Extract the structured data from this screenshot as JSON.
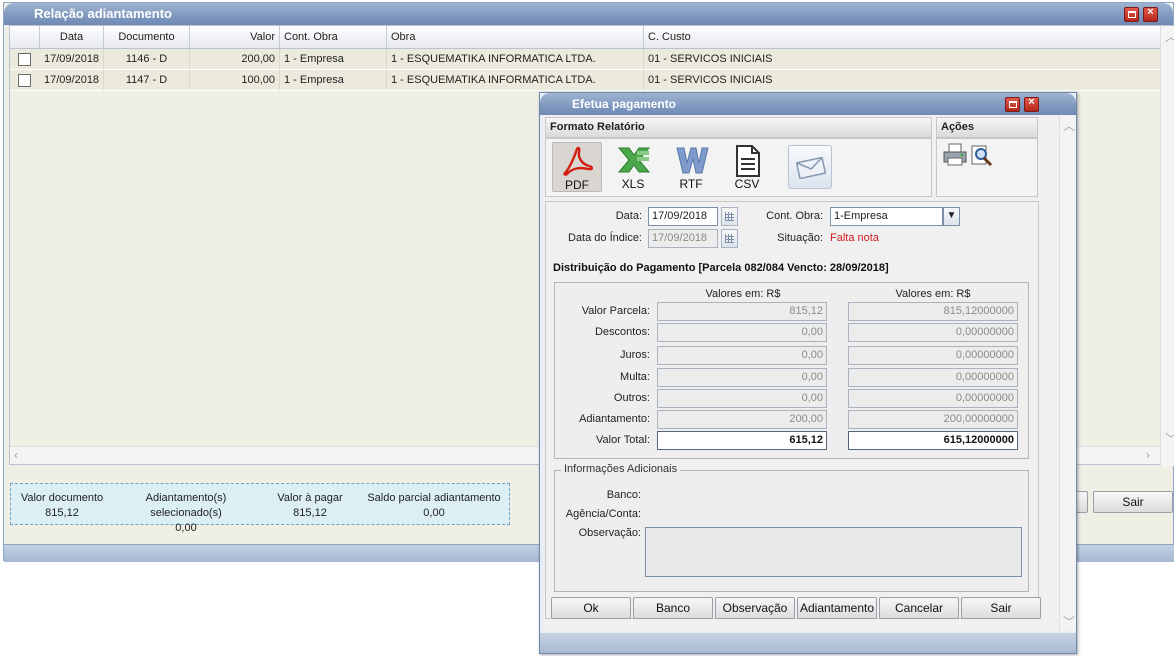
{
  "back_window": {
    "title": "Relação adiantamento",
    "columns": [
      "Data",
      "Documento",
      "Valor",
      "Cont. Obra",
      "Obra",
      "C. Custo"
    ],
    "rows": [
      {
        "data": "17/09/2018",
        "documento": "1146 - D",
        "valor": "200,00",
        "cont_obra": "1 - Empresa",
        "obra": "1 - ESQUEMATIKA INFORMATICA LTDA.",
        "c_custo": "01 - SERVICOS INICIAIS"
      },
      {
        "data": "17/09/2018",
        "documento": "1147 - D",
        "valor": "100,00",
        "cont_obra": "1 - Empresa",
        "obra": "1 - ESQUEMATIKA INFORMATICA LTDA.",
        "c_custo": "01 - SERVICOS INICIAIS"
      }
    ],
    "summary": {
      "valor_documento_label": "Valor documento",
      "valor_documento": "815,12",
      "adiantamentos_label": "Adiantamento(s) selecionado(s)",
      "adiantamentos": "0,00",
      "valor_a_pagar_label": "Valor à pagar",
      "valor_a_pagar": "815,12",
      "saldo_label": "Saldo parcial adiantamento",
      "saldo": "0,00"
    },
    "sair_label": "Sair"
  },
  "dialog": {
    "title": "Efetua pagamento",
    "formato_relatorio": "Formato Relatório",
    "acoes": "Ações",
    "formats": [
      {
        "label": "PDF",
        "icon": "pdf-icon"
      },
      {
        "label": "XLS",
        "icon": "xls-icon"
      },
      {
        "label": "RTF",
        "icon": "rtf-icon"
      },
      {
        "label": "CSV",
        "icon": "csv-icon"
      }
    ],
    "email_icon": "envelope-icon",
    "actions_icons": [
      "printer-icon",
      "print-preview-icon"
    ],
    "form": {
      "data_label": "Data:",
      "data_value": "17/09/2018",
      "data_indice_label": "Data do Índice:",
      "data_indice_value": "17/09/2018",
      "cont_obra_label": "Cont. Obra:",
      "cont_obra_value": "1-Empresa",
      "situacao_label": "Situação:",
      "situacao_value": "Falta nota"
    },
    "distribuicao_title": "Distribuição do Pagamento [Parcela 082/084 Vencto: 28/09/2018]",
    "valores_em_1": "Valores em: R$",
    "valores_em_2": "Valores em: R$",
    "dist_rows": [
      {
        "label": "Valor Parcela:",
        "v1": "815,12",
        "v2": "815,12000000"
      },
      {
        "label": "Descontos:",
        "v1": "0,00",
        "v2": "0,00000000"
      },
      {
        "label": "Juros:",
        "v1": "0,00",
        "v2": "0,00000000"
      },
      {
        "label": "Multa:",
        "v1": "0,00",
        "v2": "0,00000000"
      },
      {
        "label": "Outros:",
        "v1": "0,00",
        "v2": "0,00000000"
      },
      {
        "label": "Adiantamento:",
        "v1": "200,00",
        "v2": "200,00000000"
      },
      {
        "label": "Valor Total:",
        "v1": "615,12",
        "v2": "615,12000000"
      }
    ],
    "info": {
      "legend": "Informações Adicionais",
      "banco_label": "Banco:",
      "agencia_label": "Agência/Conta:",
      "observacao_label": "Observação:"
    },
    "buttons": {
      "ok": "Ok",
      "banco": "Banco",
      "observacao": "Observação",
      "adiantamento": "Adiantamento",
      "cancelar": "Cancelar",
      "sair": "Sair"
    }
  },
  "colors": {
    "title_bar": "#7f98bf",
    "close_red": "#c8321f",
    "summary_bg": "#dbeff5",
    "warning_red": "#d51d1d"
  }
}
